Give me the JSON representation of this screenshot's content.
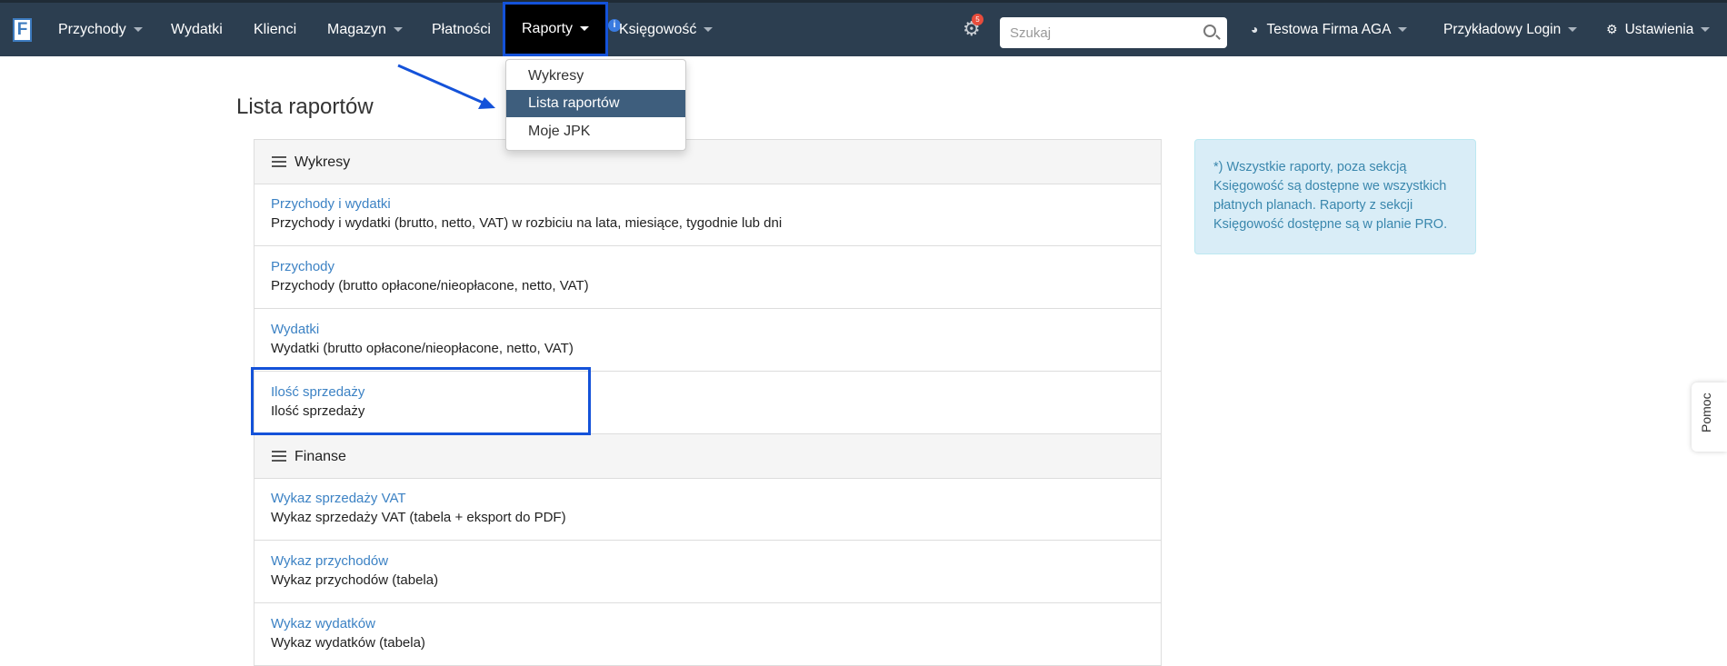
{
  "navbar": {
    "logo_letter": "F",
    "items": [
      {
        "label": "Przychody",
        "caret": true
      },
      {
        "label": "Wydatki",
        "caret": false
      },
      {
        "label": "Klienci",
        "caret": false
      },
      {
        "label": "Magazyn",
        "caret": true
      },
      {
        "label": "Płatności",
        "caret": false
      },
      {
        "label": "Raporty",
        "caret": true,
        "active": true
      },
      {
        "label": "Księgowość",
        "caret": true
      }
    ],
    "info_icon": "i",
    "notification_count": "5",
    "search": {
      "placeholder": "Szukaj"
    },
    "company": "Testowa Firma AGA",
    "login": "Przykładowy Login",
    "settings": "Ustawienia"
  },
  "dropdown": {
    "items": [
      {
        "label": "Wykresy",
        "selected": false
      },
      {
        "label": "Lista raportów",
        "selected": true
      },
      {
        "label": "Moje JPK",
        "selected": false
      }
    ]
  },
  "page": {
    "title": "Lista raportów"
  },
  "sections": [
    {
      "title": "Wykresy",
      "rows": [
        {
          "link": "Przychody i wydatki",
          "desc": "Przychody i wydatki (brutto, netto, VAT) w rozbiciu na lata, miesiące, tygodnie lub dni"
        },
        {
          "link": "Przychody",
          "desc": "Przychody (brutto opłacone/nieopłacone, netto, VAT)"
        },
        {
          "link": "Wydatki",
          "desc": "Wydatki (brutto opłacone/nieopłacone, netto, VAT)"
        },
        {
          "link": "Ilość sprzedaży",
          "desc": "Ilość sprzedaży"
        }
      ]
    },
    {
      "title": "Finanse",
      "rows": [
        {
          "link": "Wykaz sprzedaży VAT",
          "desc": "Wykaz sprzedaży VAT (tabela + eksport do PDF)"
        },
        {
          "link": "Wykaz przychodów",
          "desc": "Wykaz przychodów (tabela)"
        },
        {
          "link": "Wykaz wydatków",
          "desc": "Wykaz wydatków (tabela)"
        }
      ]
    }
  ],
  "info_box": {
    "text": "*) Wszystkie raporty, poza sekcją Księgowość są dostępne we wszystkich płatnych planach. Raporty z sekcji Księgowość dostępne są w planie PRO."
  },
  "help_tab": "Pomoc",
  "colors": {
    "navbar_bg": "#2c3e50",
    "link": "#3c82c4",
    "highlight_border": "#1452d9",
    "dropdown_selected": "#3e5e7d",
    "alert_bg": "#d9edf7"
  }
}
